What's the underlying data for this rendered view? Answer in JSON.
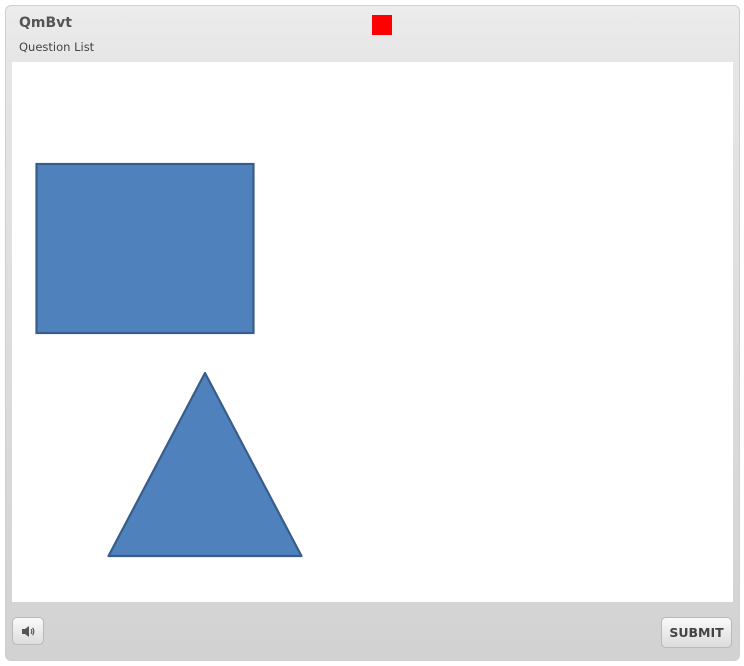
{
  "header": {
    "title": "QmBvt",
    "subtitle": "Question List",
    "flag_color": "#ff0000"
  },
  "stage": {
    "shapes": [
      {
        "kind": "rectangle",
        "fill": "#4f81bd",
        "stroke": "#385d8a"
      },
      {
        "kind": "triangle",
        "fill": "#4f81bd",
        "stroke": "#385d8a"
      }
    ]
  },
  "footer": {
    "audio_icon": "speaker-icon",
    "submit_label": "SUBMIT"
  }
}
